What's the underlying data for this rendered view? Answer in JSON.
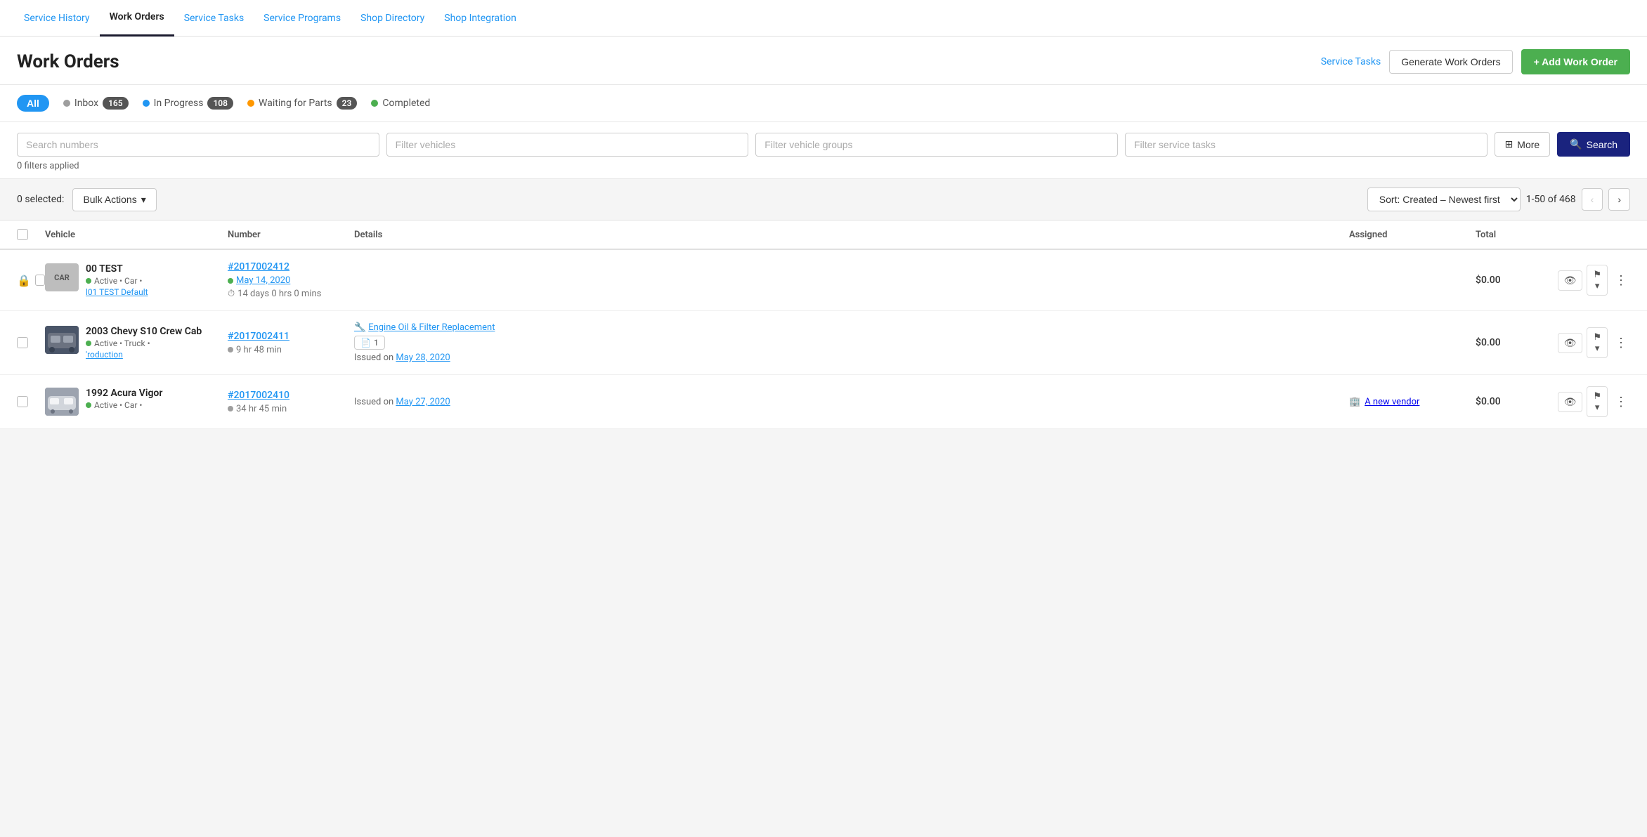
{
  "nav": {
    "items": [
      {
        "label": "Service History",
        "active": false
      },
      {
        "label": "Work Orders",
        "active": true
      },
      {
        "label": "Service Tasks",
        "active": false
      },
      {
        "label": "Service Programs",
        "active": false
      },
      {
        "label": "Shop Directory",
        "active": false
      },
      {
        "label": "Shop Integration",
        "active": false
      }
    ]
  },
  "header": {
    "title": "Work Orders",
    "service_tasks_link": "Service Tasks",
    "generate_btn": "Generate Work Orders",
    "add_btn": "+ Add Work Order"
  },
  "status_tabs": {
    "all_label": "All",
    "items": [
      {
        "label": "Inbox",
        "count": "165",
        "dot": "gray"
      },
      {
        "label": "In Progress",
        "count": "108",
        "dot": "blue"
      },
      {
        "label": "Waiting for Parts",
        "count": "23",
        "dot": "orange"
      },
      {
        "label": "Completed",
        "count": null,
        "dot": "green"
      }
    ]
  },
  "filters": {
    "search_numbers_placeholder": "Search numbers",
    "filter_vehicles_placeholder": "Filter vehicles",
    "filter_vehicle_groups_placeholder": "Filter vehicle groups",
    "filter_service_tasks_placeholder": "Filter service tasks",
    "more_btn": "More",
    "search_btn": "Search",
    "filters_applied": "0 filters applied"
  },
  "bulk": {
    "selected_label": "0 selected:",
    "bulk_actions_label": "Bulk Actions",
    "sort_label": "Sort: Created – Newest first",
    "pagination": "1-50 of 468"
  },
  "table": {
    "columns": [
      "",
      "Vehicle",
      "Number",
      "Details",
      "Assigned",
      "Total",
      ""
    ],
    "rows": [
      {
        "id": 1,
        "locked": true,
        "thumb_type": "text",
        "thumb_text": "CAR",
        "thumb_bg": "#bdbdbd",
        "vehicle_name": "00 TEST",
        "status_dot": "green",
        "vehicle_meta": "Active • Car •",
        "vehicle_group": "l01 TEST Default",
        "work_order_num": "#2017002412",
        "wo_date": "May 14, 2020",
        "wo_time": "14 days 0 hrs 0 mins",
        "details_service": null,
        "details_badge": null,
        "details_issued": null,
        "assigned": null,
        "total": "$0.00"
      },
      {
        "id": 2,
        "locked": false,
        "thumb_type": "image",
        "thumb_text": "",
        "thumb_bg": "#555",
        "vehicle_name": "2003 Chevy S10 Crew Cab",
        "status_dot": "green",
        "vehicle_meta": "Active • Truck •",
        "vehicle_group": "'roduction",
        "work_order_num": "#2017002411",
        "wo_date": null,
        "wo_time": "9 hr 48 min",
        "wo_time_dot": "gray",
        "details_service": "Engine Oil & Filter Replacement",
        "details_badge": "1",
        "details_issued": "May 28, 2020",
        "assigned": null,
        "total": "$0.00"
      },
      {
        "id": 3,
        "locked": false,
        "thumb_type": "image",
        "thumb_text": "",
        "thumb_bg": "#888",
        "vehicle_name": "1992 Acura Vigor",
        "status_dot": "green",
        "vehicle_meta": "Active • Car •",
        "vehicle_group": null,
        "work_order_num": "#2017002410",
        "wo_date": null,
        "wo_time": "34 hr 45 min",
        "wo_time_dot": "gray",
        "details_service": null,
        "details_badge": null,
        "details_issued": "May 27, 2020",
        "assigned": "A new vendor",
        "assigned_icon": "building",
        "total": "$0.00"
      }
    ]
  }
}
